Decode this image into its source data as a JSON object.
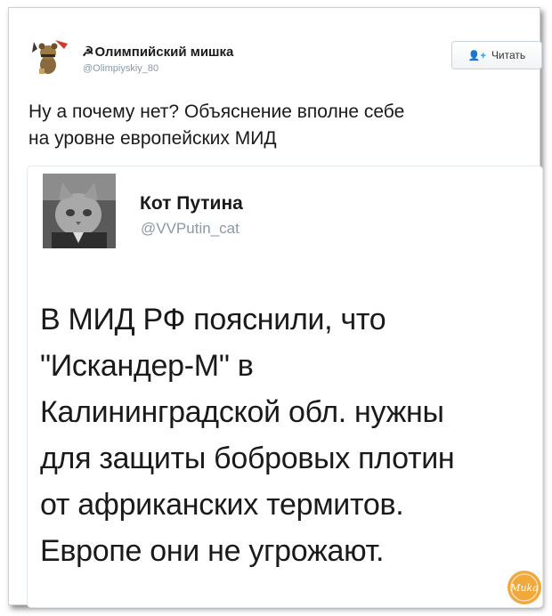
{
  "author": {
    "party_icon": "☭",
    "name": "Олимпийский мишка",
    "handle": "@Olimpiyskiy_80"
  },
  "follow_button": {
    "icon": "👤+",
    "label": "Читать"
  },
  "tweet": {
    "text_line1": "Ну а почему нет? Объяснение вполне себе",
    "text_line2": "на уровне европейских МИД"
  },
  "quoted": {
    "name": "Кот Путина",
    "handle": "@VVPutin_cat",
    "lines": [
      "В МИД РФ пояснили, что",
      "\"Искандер-М\" в",
      "Калининградской обл. нужны",
      "для защиты бобровых плотин",
      "от африканских термитов.",
      "Европе они не угрожают."
    ]
  },
  "watermark": {
    "text": "Muka",
    "color": "#f2a93b"
  },
  "colors": {
    "link_blue": "#2b9be3",
    "muted": "#8899a6"
  }
}
